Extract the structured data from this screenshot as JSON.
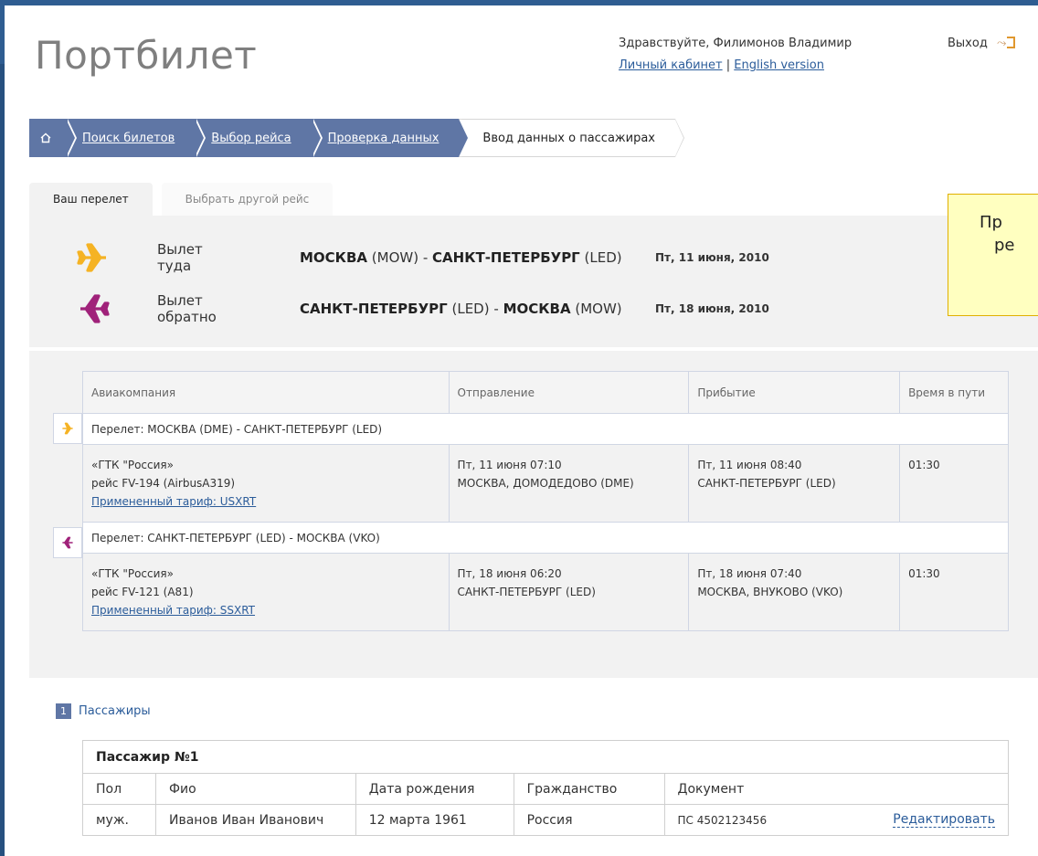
{
  "header": {
    "logo": "Портбилет",
    "greeting": "Здравствуйте, Филимонов Владимир",
    "cabinet_link": "Личный кабинет",
    "separator": "|",
    "english_link": "English version",
    "logout": "Выход"
  },
  "breadcrumb": {
    "home_icon": "home-icon",
    "items": [
      "Поиск билетов",
      "Выбор рейса",
      "Проверка данных"
    ],
    "current": "Ввод данных о пассажирах"
  },
  "tabs": {
    "active": "Ваш перелет",
    "other": "Выбрать другой рейс"
  },
  "summary": {
    "outbound": {
      "label": "Вылет туда",
      "from_city": "МОСКВА",
      "from_code": "(MOW) -",
      "to_city": "САНКТ-ПЕТЕРБУРГ",
      "to_code": "(LED)",
      "date": "Пт, 11 июня, 2010"
    },
    "return": {
      "label": "Вылет обратно",
      "from_city": "САНКТ-ПЕТЕРБУРГ",
      "from_code": "(LED) -",
      "to_city": "МОСКВА",
      "to_code": "(MOW)",
      "date": "Пт, 18 июня, 2010"
    }
  },
  "tooltip": {
    "line1": "Пр",
    "line2": "ре"
  },
  "flights_table": {
    "headers": [
      "Авиакомпания",
      "Отправление",
      "Прибытие",
      "Время в пути"
    ],
    "legs": [
      {
        "title": "Перелет: МОСКВА (DME) - САНКТ-ПЕТЕРБУРГ (LED)",
        "airline": "«ГТК \"Россия»",
        "flight": "рейс FV-194 (AirbusA319)",
        "tariff": "Примененный тариф: USXRT",
        "dep_time": "Пт, 11 июня 07:10",
        "dep_place": "МОСКВА, ДОМОДЕДОВО (DME)",
        "arr_time": "Пт, 11 июня 08:40",
        "arr_place": "САНКТ-ПЕТЕРБУРГ (LED)",
        "duration": "01:30"
      },
      {
        "title": "Перелет: САНКТ-ПЕТЕРБУРГ (LED) - МОСКВА (VKO)",
        "airline": "«ГТК \"Россия»",
        "flight": "рейс FV-121 (A81)",
        "tariff": "Примененный тариф: SSXRT",
        "dep_time": "Пт, 18 июня 06:20",
        "dep_place": "САНКТ-ПЕТЕРБУРГ (LED)",
        "arr_time": "Пт, 18 июня 07:40",
        "arr_place": "МОСКВА, ВНУКОВО (VKO)",
        "duration": "01:30"
      }
    ]
  },
  "passengers": {
    "section_number": "1",
    "section_title": "Пассажиры",
    "card_title": "Пассажир №1",
    "headers": [
      "Пол",
      "Фио",
      "Дата рождения",
      "Гражданство",
      "Документ"
    ],
    "row": {
      "gender": "муж.",
      "name": "Иванов Иван Иванович",
      "birth": "12 марта 1961",
      "citizenship": "Россия",
      "document": "ПС 4502123456",
      "edit": "Редактировать"
    }
  },
  "colors": {
    "frame": "#2f5d91",
    "breadcrumb": "#5f76a5",
    "outbound_plane": "#f5b324",
    "return_plane": "#a0227a",
    "link": "#2b5c9a"
  }
}
